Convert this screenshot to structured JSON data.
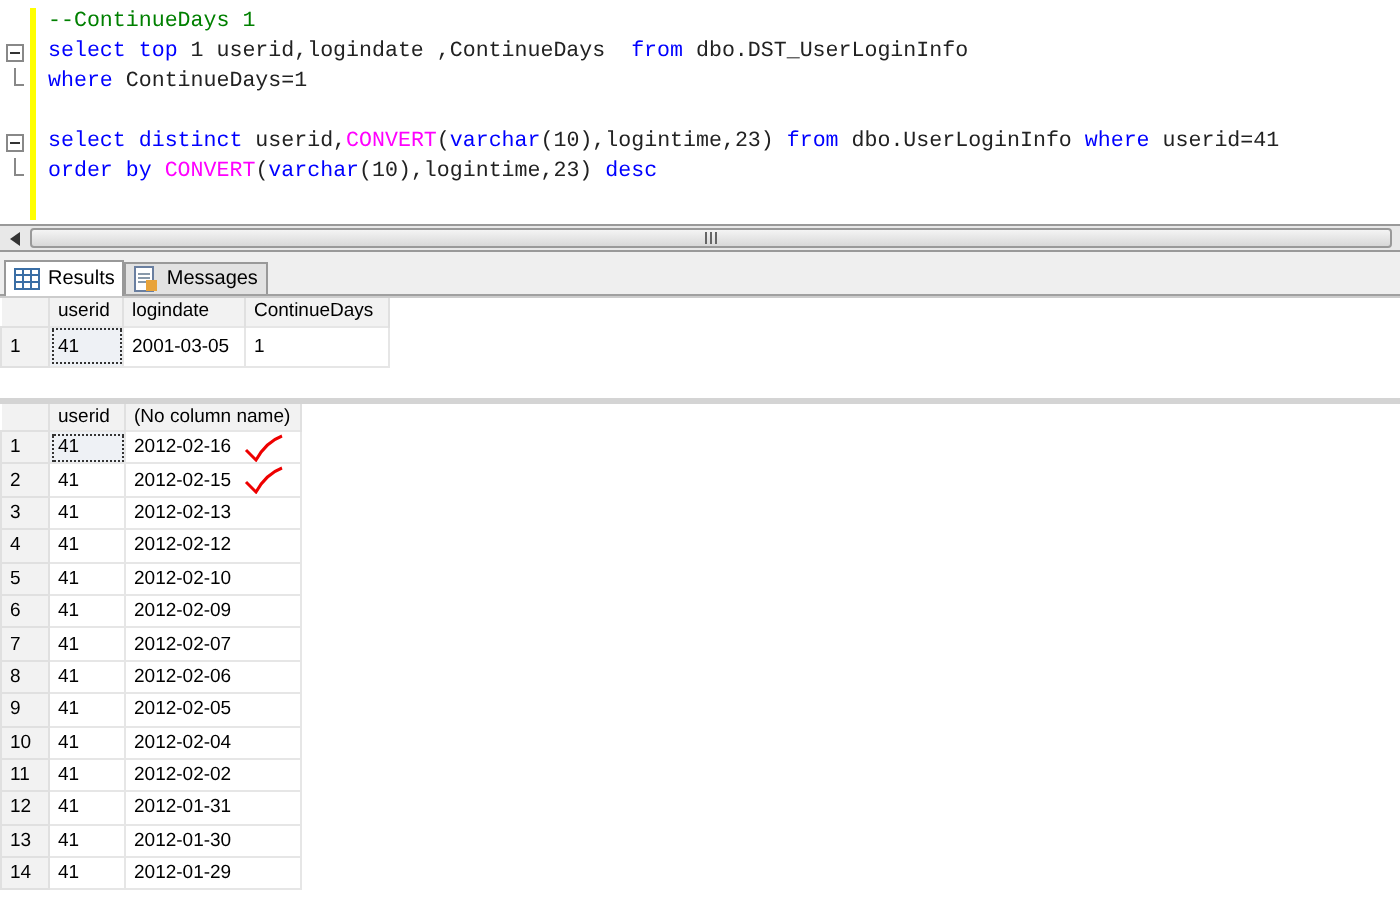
{
  "editor": {
    "blocks": [
      {
        "blank_before": false,
        "lines": [
          {
            "tokens": [
              {
                "kind": "comment",
                "text": "--ContinueDays 1"
              }
            ]
          }
        ]
      },
      {
        "blank_before": false,
        "lines": [
          {
            "tokens": [
              {
                "kind": "keyword",
                "text": "select top"
              },
              {
                "kind": "plain",
                "text": " 1 userid,logindate ,ContinueDays  "
              },
              {
                "kind": "keyword",
                "text": "from"
              },
              {
                "kind": "plain",
                "text": " dbo.DST_UserLoginInfo"
              }
            ]
          },
          {
            "tokens": [
              {
                "kind": "keyword",
                "text": "where"
              },
              {
                "kind": "plain",
                "text": " ContinueDays=1"
              }
            ]
          }
        ]
      },
      {
        "blank_before": true,
        "lines": [
          {
            "tokens": [
              {
                "kind": "keyword",
                "text": "select distinct"
              },
              {
                "kind": "plain",
                "text": " userid,"
              },
              {
                "kind": "function",
                "text": "CONVERT"
              },
              {
                "kind": "plain",
                "text": "("
              },
              {
                "kind": "keyword",
                "text": "varchar"
              },
              {
                "kind": "plain",
                "text": "(10),logintime,23) "
              },
              {
                "kind": "keyword",
                "text": "from"
              },
              {
                "kind": "plain",
                "text": " dbo.UserLoginInfo "
              },
              {
                "kind": "keyword",
                "text": "where"
              },
              {
                "kind": "plain",
                "text": " userid=41"
              }
            ]
          },
          {
            "tokens": [
              {
                "kind": "keyword",
                "text": "order by "
              },
              {
                "kind": "function",
                "text": "CONVERT"
              },
              {
                "kind": "plain",
                "text": "("
              },
              {
                "kind": "keyword",
                "text": "varchar"
              },
              {
                "kind": "plain",
                "text": "(10),logintime,23) "
              },
              {
                "kind": "keyword",
                "text": "desc"
              }
            ]
          }
        ]
      }
    ]
  },
  "tabs": [
    {
      "label": "Results",
      "selected": true
    },
    {
      "label": "Messages",
      "selected": false
    }
  ],
  "grids": [
    {
      "columns": [
        "userid",
        "logindate",
        "ContinueDays"
      ],
      "rows": [
        {
          "number": "1",
          "cells": [
            "41",
            "2001-03-05",
            "1"
          ],
          "annotated": false
        }
      ]
    },
    {
      "columns": [
        "userid",
        "(No column name)"
      ],
      "rows": [
        {
          "number": "1",
          "cells": [
            "41",
            "2012-02-16"
          ],
          "annotated": true
        },
        {
          "number": "2",
          "cells": [
            "41",
            "2012-02-15"
          ],
          "annotated": true
        },
        {
          "number": "3",
          "cells": [
            "41",
            "2012-02-13"
          ],
          "annotated": false
        },
        {
          "number": "4",
          "cells": [
            "41",
            "2012-02-12"
          ],
          "annotated": false
        },
        {
          "number": "5",
          "cells": [
            "41",
            "2012-02-10"
          ],
          "annotated": false
        },
        {
          "number": "6",
          "cells": [
            "41",
            "2012-02-09"
          ],
          "annotated": false
        },
        {
          "number": "7",
          "cells": [
            "41",
            "2012-02-07"
          ],
          "annotated": false
        },
        {
          "number": "8",
          "cells": [
            "41",
            "2012-02-06"
          ],
          "annotated": false
        },
        {
          "number": "9",
          "cells": [
            "41",
            "2012-02-05"
          ],
          "annotated": false
        },
        {
          "number": "10",
          "cells": [
            "41",
            "2012-02-04"
          ],
          "annotated": false
        },
        {
          "number": "11",
          "cells": [
            "41",
            "2012-02-02"
          ],
          "annotated": false
        },
        {
          "number": "12",
          "cells": [
            "41",
            "2012-01-31"
          ],
          "annotated": false
        },
        {
          "number": "13",
          "cells": [
            "41",
            "2012-01-30"
          ],
          "annotated": false
        },
        {
          "number": "14",
          "cells": [
            "41",
            "2012-01-29"
          ],
          "annotated": false
        }
      ]
    }
  ]
}
